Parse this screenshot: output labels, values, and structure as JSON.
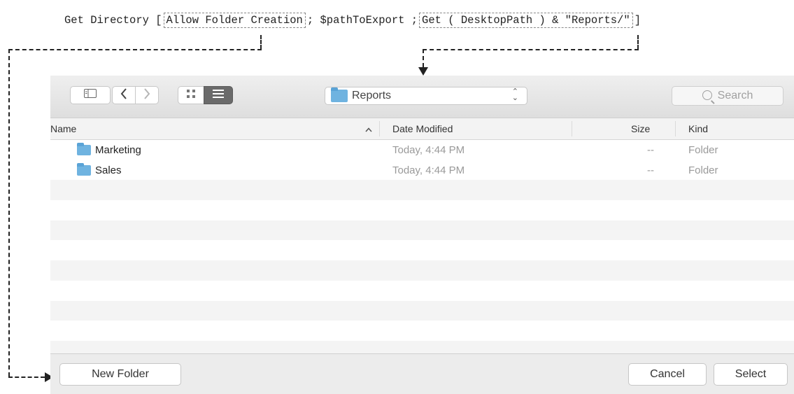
{
  "script": {
    "prefix": "Get Directory [",
    "option1": "Allow Folder Creation",
    "sep": ";",
    "variable": "$pathToExport",
    "sep2": ";",
    "option2": "Get ( DesktopPath ) & \"Reports/\"",
    "suffix": "]"
  },
  "toolbar": {
    "sidebar_icon": "sidebar-toggle-icon",
    "back_icon": "chevron-left-icon",
    "forward_icon": "chevron-right-icon",
    "icon_view_icon": "icon-view-grid-icon",
    "list_view_icon": "list-view-icon",
    "location": "Reports",
    "location_icon": "folder-icon",
    "search_placeholder": "Search"
  },
  "columns": {
    "name": "Name",
    "sort_indicator": "^",
    "date_modified": "Date Modified",
    "size": "Size",
    "kind": "Kind"
  },
  "rows": [
    {
      "name": "Marketing",
      "date": "Today, 4:44 PM",
      "size": "--",
      "kind": "Folder"
    },
    {
      "name": "Sales",
      "date": "Today, 4:44 PM",
      "size": "--",
      "kind": "Folder"
    }
  ],
  "footer": {
    "new_folder": "New Folder",
    "cancel": "Cancel",
    "select": "Select"
  },
  "colors": {
    "folder": "#6fb3e0",
    "toolbar": "#e6e6e6"
  }
}
